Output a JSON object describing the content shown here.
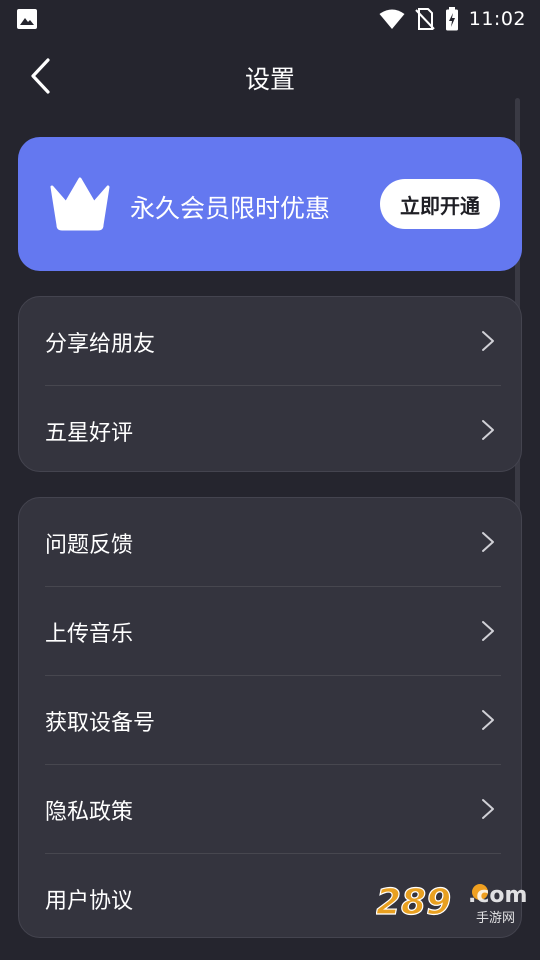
{
  "status_bar": {
    "time": "11:02",
    "icons": [
      "image-icon",
      "wifi-icon",
      "no-sim-icon",
      "battery-charging-icon"
    ]
  },
  "header": {
    "title": "设置",
    "back_icon": "chevron-left-icon"
  },
  "vip_banner": {
    "icon": "crown-icon",
    "text": "永久会员限时优惠",
    "button_label": "立即开通",
    "background_color": "#6478f0"
  },
  "group1": {
    "items": [
      {
        "label": "分享给朋友"
      },
      {
        "label": "五星好评"
      }
    ]
  },
  "group2": {
    "items": [
      {
        "label": "问题反馈"
      },
      {
        "label": "上传音乐"
      },
      {
        "label": "获取设备号"
      },
      {
        "label": "隐私政策"
      },
      {
        "label": "用户协议"
      }
    ]
  },
  "watermark": {
    "number": "289",
    "suffix": ".com",
    "caption": "手游网"
  },
  "colors": {
    "background": "#25252e",
    "card": "#34343e",
    "accent": "#6478f0"
  }
}
